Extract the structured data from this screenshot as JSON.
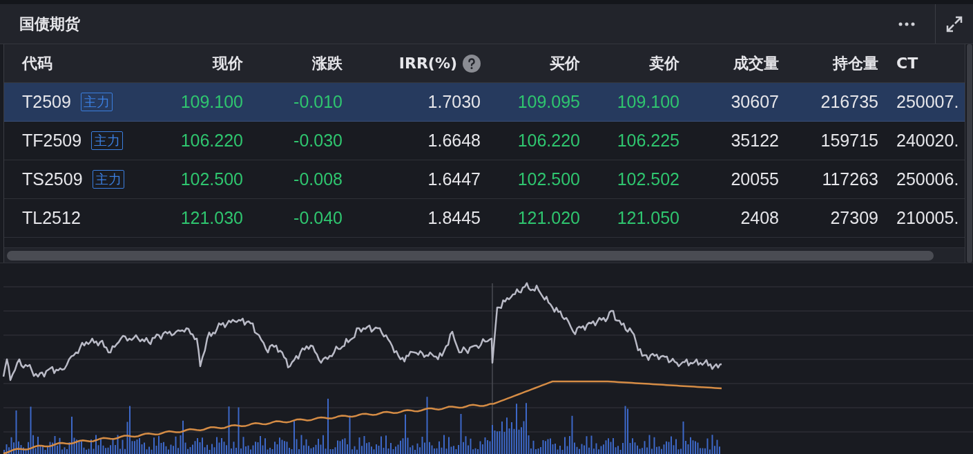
{
  "panel": {
    "title": "国债期货"
  },
  "table": {
    "columns": [
      {
        "label": "代码",
        "kind": "code"
      },
      {
        "label": "现价",
        "kind": "change"
      },
      {
        "label": "涨跌",
        "kind": "change"
      },
      {
        "label": "IRR(%)",
        "kind": "plain",
        "help": true
      },
      {
        "label": "买价",
        "kind": "change"
      },
      {
        "label": "卖价",
        "kind": "change"
      },
      {
        "label": "成交量",
        "kind": "plain"
      },
      {
        "label": "持仓量",
        "kind": "plain"
      },
      {
        "label": "CT",
        "kind": "cut"
      }
    ],
    "rows": [
      {
        "selected": true,
        "badge": "主力",
        "cells": [
          "T2509",
          "109.100",
          "-0.010",
          "1.7030",
          "109.095",
          "109.100",
          "30607",
          "216735",
          "250007."
        ]
      },
      {
        "selected": false,
        "badge": "主力",
        "cells": [
          "TF2509",
          "106.220",
          "-0.030",
          "1.6648",
          "106.220",
          "106.225",
          "35122",
          "159715",
          "240020."
        ]
      },
      {
        "selected": false,
        "badge": "主力",
        "cells": [
          "TS2509",
          "102.500",
          "-0.008",
          "1.6447",
          "102.500",
          "102.502",
          "20055",
          "117263",
          "250006."
        ]
      },
      {
        "selected": false,
        "cells": [
          "TL2512",
          "121.030",
          "-0.040",
          "1.8445",
          "121.020",
          "121.050",
          "2408",
          "27309",
          "210005."
        ]
      }
    ]
  }
}
